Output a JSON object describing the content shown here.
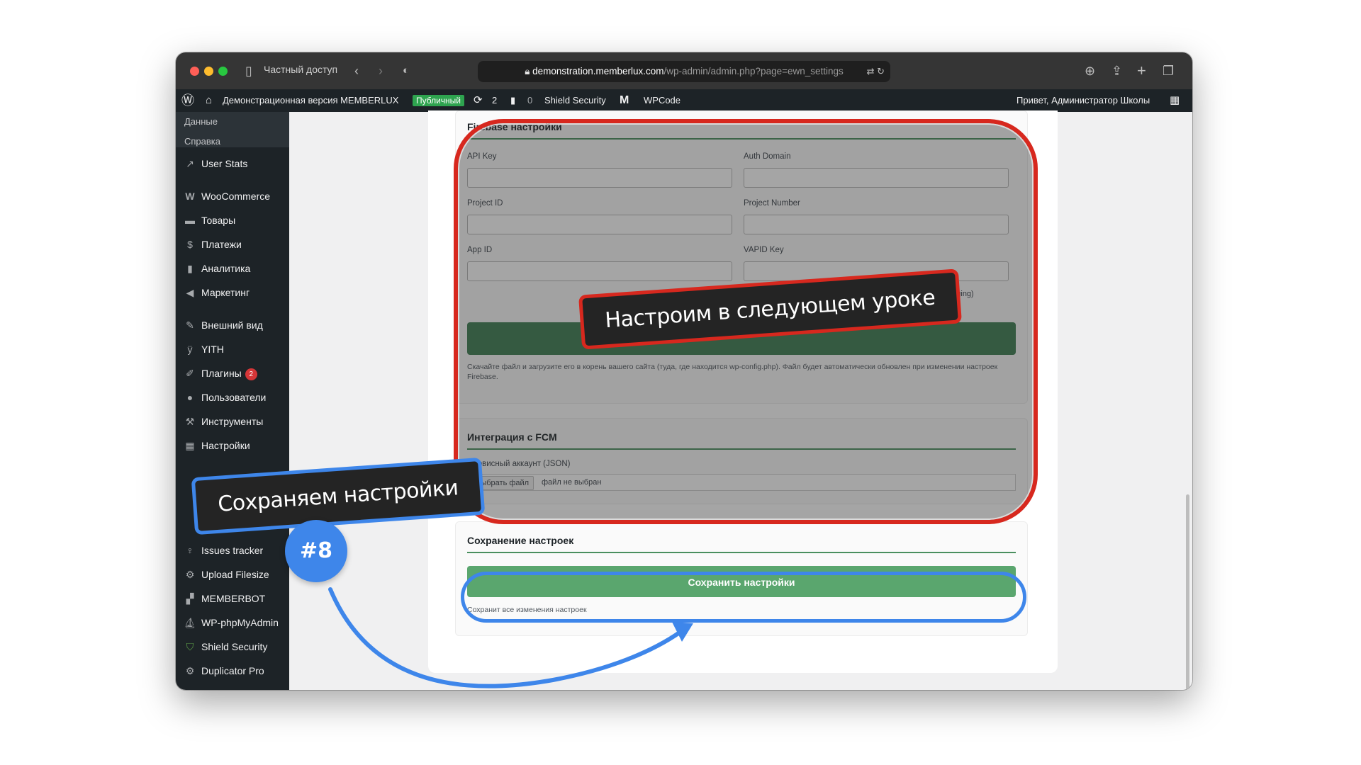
{
  "browser": {
    "private_label": "Частный доступ",
    "url_domain": "demonstration.memberlux.com",
    "url_path": "/wp-admin/admin.php?page=ewn_settings"
  },
  "admin_bar": {
    "site_name": "Демонстрационная версия MEMBERLUX",
    "public_badge": "Публичный",
    "updates_count": "2",
    "comments_count": "0",
    "shield_security": "Shield Security",
    "wpcode": "WPCode",
    "greeting": "Привет, Администратор Школы"
  },
  "sidebar": {
    "submenu": [
      "Данные",
      "Справка"
    ],
    "items": [
      {
        "label": "User Stats",
        "icon": "chart-line-icon"
      },
      {
        "label": "WooCommerce",
        "icon": "woo-icon"
      },
      {
        "label": "Товары",
        "icon": "archive-icon"
      },
      {
        "label": "Платежи",
        "icon": "dollar-icon"
      },
      {
        "label": "Аналитика",
        "icon": "bar-chart-icon"
      },
      {
        "label": "Маркетинг",
        "icon": "megaphone-icon"
      },
      {
        "label": "Внешний вид",
        "icon": "brush-icon"
      },
      {
        "label": "YITH",
        "icon": "yith-icon"
      },
      {
        "label": "Плагины",
        "icon": "plugin-icon",
        "badge": "2"
      },
      {
        "label": "Пользователи",
        "icon": "user-icon"
      },
      {
        "label": "Инструменты",
        "icon": "wrench-icon"
      },
      {
        "label": "Настройки",
        "icon": "settings-icon"
      },
      {
        "label": "Issues tracker",
        "icon": "bulb-icon"
      },
      {
        "label": "Upload Filesize",
        "icon": "gear-icon"
      },
      {
        "label": "MEMBERBOT",
        "icon": "chat-icon"
      },
      {
        "label": "WP-phpMyAdmin",
        "icon": "sailboat-icon"
      },
      {
        "label": "Shield Security",
        "icon": "shield-icon"
      },
      {
        "label": "Duplicator Pro",
        "icon": "duplicator-icon"
      }
    ]
  },
  "firebase": {
    "title": "Firebase настройки",
    "fields": {
      "api_key": "API Key",
      "auth_domain": "Auth Domain",
      "project_id": "Project ID",
      "project_number": "Project Number",
      "app_id": "App ID",
      "vapid_key": "VAPID Key"
    },
    "vapid_hint": "→ Cloud Messaging)",
    "note": "Скачайте файл и загрузите его в корень вашего сайта (туда, где находится wp-config.php). Файл будет автоматически обновлен при изменении настроек Firebase."
  },
  "fcm": {
    "title": "Интеграция с FCM",
    "service_account_label": "Сервисный аккаунт (JSON)",
    "choose_file": "Выбрать файл",
    "no_file": "файл не выбран"
  },
  "save_section": {
    "title": "Сохранение настроек",
    "button": "Сохранить настройки",
    "note": "Сохранит все изменения настроек"
  },
  "annotations": {
    "next_lesson": "Настроим в следующем уроке",
    "save_callout": "Сохраняем настройки",
    "step_badge": "#8"
  },
  "colors": {
    "highlight_red": "#d7281e",
    "highlight_blue": "#3e86ea",
    "save_green": "#5aa66e",
    "wp_dark": "#1d2327"
  }
}
